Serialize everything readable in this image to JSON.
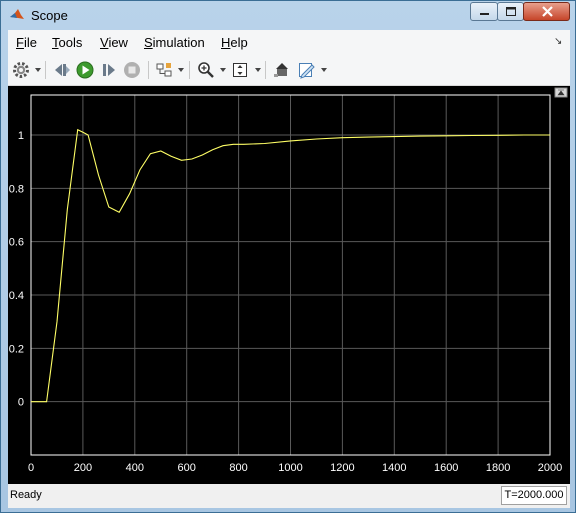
{
  "window": {
    "title": "Scope",
    "app_icon": "matlab-logo-icon"
  },
  "menu": {
    "items": [
      {
        "label": "File",
        "mnemonic": "F",
        "rest": "ile"
      },
      {
        "label": "Tools",
        "mnemonic": "T",
        "rest": "ools"
      },
      {
        "label": "View",
        "mnemonic": "V",
        "rest": "iew"
      },
      {
        "label": "Simulation",
        "mnemonic": "S",
        "rest": "imulation"
      },
      {
        "label": "Help",
        "mnemonic": "H",
        "rest": "elp"
      }
    ]
  },
  "toolbar": {
    "icons": [
      "gear-icon",
      "step-back-icon",
      "run-icon",
      "step-forward-icon",
      "stop-icon",
      "signal-select-icon",
      "zoom-icon",
      "autoscale-icon",
      "highlight-block-icon",
      "properties-icon"
    ]
  },
  "status": {
    "text": "Ready",
    "time": "T=2000.000"
  },
  "colors": {
    "trace": "#ffff66",
    "background": "#000000",
    "grid": "#5a5a5a",
    "axes": "#ffffff"
  },
  "chart_data": {
    "type": "line",
    "xlim": [
      0,
      2000
    ],
    "ylim": [
      -0.2,
      1.15
    ],
    "xticks": [
      0,
      200,
      400,
      600,
      800,
      1000,
      1200,
      1400,
      1600,
      1800,
      2000
    ],
    "yticks": [
      0,
      0.2,
      0.4,
      0.6,
      0.8,
      1
    ],
    "grid": true,
    "series": [
      {
        "color": "#ffff66",
        "x": [
          0,
          60,
          100,
          140,
          180,
          200,
          220,
          260,
          300,
          340,
          380,
          420,
          460,
          500,
          540,
          580,
          620,
          660,
          700,
          740,
          780,
          820,
          900,
          1000,
          1100,
          1200,
          1300,
          1400,
          1500,
          1600,
          1700,
          1800,
          1900,
          2000
        ],
        "y": [
          0,
          0,
          0.3,
          0.72,
          1.02,
          1.01,
          1.0,
          0.85,
          0.73,
          0.71,
          0.78,
          0.87,
          0.93,
          0.94,
          0.92,
          0.905,
          0.91,
          0.925,
          0.945,
          0.96,
          0.965,
          0.965,
          0.968,
          0.978,
          0.985,
          0.99,
          0.992,
          0.994,
          0.996,
          0.997,
          0.998,
          0.999,
          1.0,
          1.0
        ]
      }
    ]
  }
}
